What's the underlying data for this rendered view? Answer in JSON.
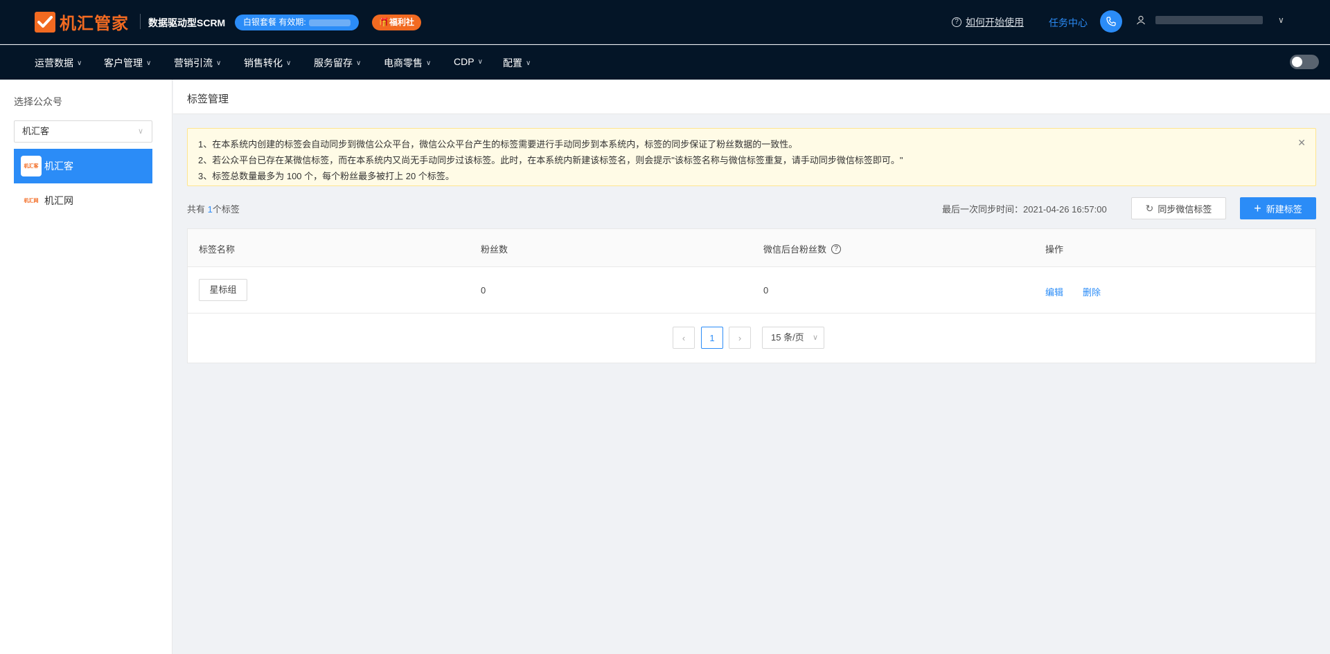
{
  "header": {
    "brand": "机汇管家",
    "slogan": "数据驱动型SCRM",
    "plan_badge": "白银套餐 有效期:",
    "welfare_badge": "🎁福利社",
    "help_label": "如何开始使用",
    "task_center": "任务中心",
    "user_menu_chevron": "∨"
  },
  "nav": {
    "items": [
      "运营数据",
      "客户管理",
      "营销引流",
      "销售转化",
      "服务留存",
      "电商零售",
      "CDP",
      "配置"
    ]
  },
  "sidebar": {
    "title": "选择公众号",
    "select_value": "机汇客",
    "accounts": [
      {
        "name": "机汇客",
        "logo_text": "机汇客",
        "active": true
      },
      {
        "name": "机汇网",
        "logo_text": "机汇网",
        "active": false
      }
    ]
  },
  "page": {
    "title": "标签管理",
    "notice": [
      "1、在本系统内创建的标签会自动同步到微信公众平台，微信公众平台产生的标签需要进行手动同步到本系统内，标签的同步保证了粉丝数据的一致性。",
      "2、若公众平台已存在某微信标签，而在本系统内又尚无手动同步过该标签。此时，在本系统内新建该标签名，则会提示\"该标签名称与微信标签重复，请手动同步微信标签即可。\"",
      "3、标签总数量最多为 100 个，每个粉丝最多被打上 20 个标签。"
    ],
    "count_prefix": "共有 ",
    "count_value": "1",
    "count_suffix": "个标签",
    "sync_time": "最后一次同步时间：2021-04-26 16:57:00",
    "sync_button": "同步微信标签",
    "new_button": "新建标签"
  },
  "table": {
    "headers": [
      "标签名称",
      "粉丝数",
      "微信后台粉丝数",
      "操作"
    ],
    "rows": [
      {
        "name": "星标组",
        "fans": "0",
        "wx_fans": "0",
        "edit": "编辑",
        "delete": "删除"
      }
    ]
  },
  "pagination": {
    "current_page": "1",
    "page_size": "15 条/页"
  },
  "colors": {
    "brand_orange": "#f26a21",
    "primary_blue": "#2b8cf7",
    "header_bg": "#041527",
    "notice_bg": "#fffbe6"
  }
}
